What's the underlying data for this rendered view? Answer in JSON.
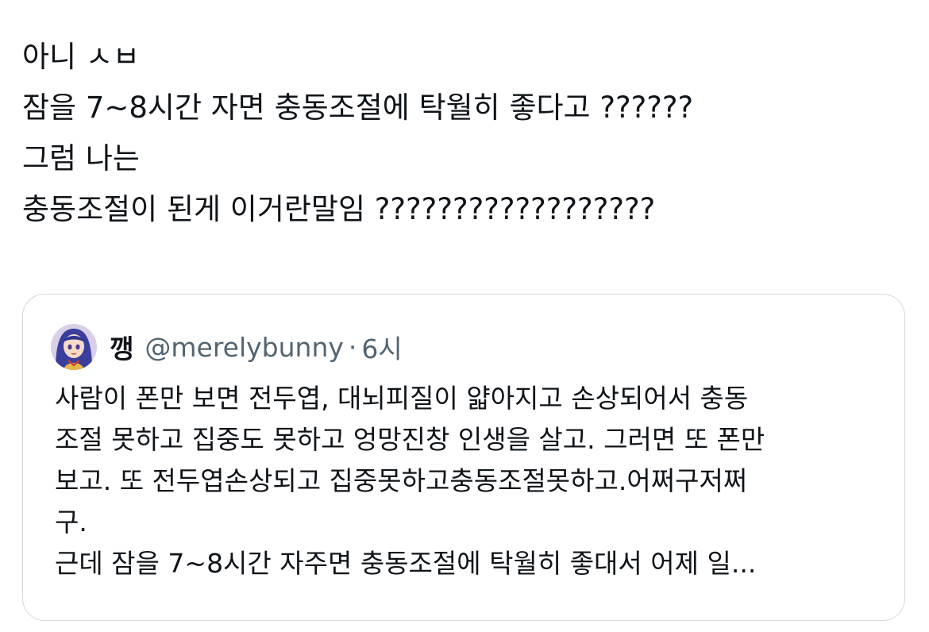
{
  "tweet": {
    "lines": [
      "아니 ㅅㅂ",
      "잠을 7~8시간 자면 충동조절에 탁월히 좋다고 ??????",
      "그럼 나는",
      "충동조절이 된게 이거란말임 ??????????????????"
    ]
  },
  "quoted_tweet": {
    "avatar_icon": "anime-character-avatar-icon",
    "author_name": "깽",
    "handle": "@merelybunny",
    "separator": "·",
    "time": "6시",
    "text_lines": [
      "사람이 폰만 보면 전두엽, 대뇌피질이 얇아지고 손상되어서 충동",
      "조절 못하고 집중도 못하고 엉망진창 인생을 살고. 그러면 또 폰만",
      "보고. 또 전두엽손상되고 집중못하고충동조절못하고.어쩌구저쩌",
      "구.",
      "근데 잠을 7~8시간 자주면 충동조절에 탁월히 좋대서 어제 일..."
    ]
  },
  "colors": {
    "text_primary": "#0f1419",
    "text_secondary": "#536471",
    "card_border": "#cfd9de",
    "background": "#ffffff"
  }
}
